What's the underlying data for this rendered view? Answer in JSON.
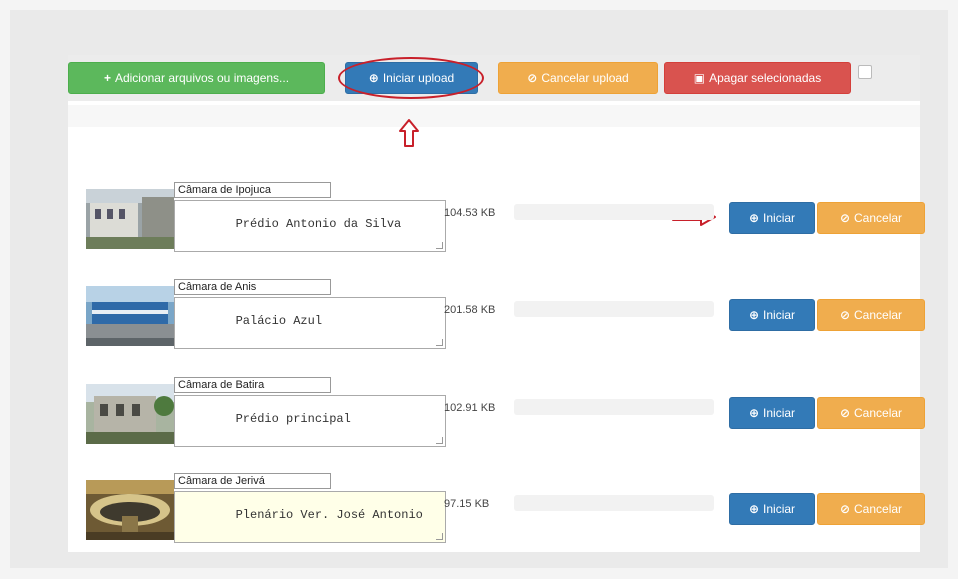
{
  "toolbar": {
    "add_label": "Adicionar arquivos ou imagens...",
    "start_label": "Iniciar upload",
    "cancel_label": "Cancelar upload",
    "delete_label": "Apagar selecionadas"
  },
  "icons": {
    "plus": "+",
    "upload": "⊕",
    "ban": "⊘",
    "trash": "▣"
  },
  "files": [
    {
      "title": "Câmara de Ipojuca",
      "description": "Prédio Antonio da Silva",
      "size": "104.53 KB",
      "start": "Iniciar",
      "cancel": "Cancelar"
    },
    {
      "title": "Câmara de Anis",
      "description": "Palácio Azul",
      "size": "201.58 KB",
      "start": "Iniciar",
      "cancel": "Cancelar"
    },
    {
      "title": "Câmara de Batira",
      "description": "Prédio principal",
      "size": "102.91 KB",
      "start": "Iniciar",
      "cancel": "Cancelar"
    },
    {
      "title": "Câmara de Jerivá",
      "description": "Plenário Ver. José Antonio",
      "size": "97.15 KB",
      "start": "Iniciar",
      "cancel": "Cancelar"
    }
  ],
  "colors": {
    "green": "#5cb85c",
    "blue": "#337ab7",
    "orange": "#f0ad4e",
    "red": "#d9534f",
    "annotation": "#c8202a"
  }
}
